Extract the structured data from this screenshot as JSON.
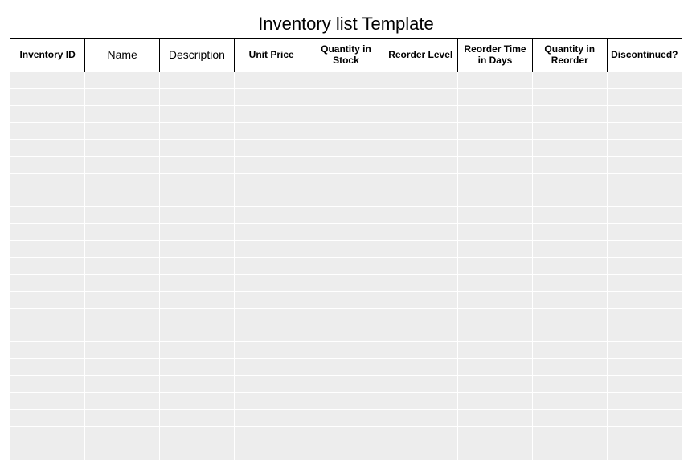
{
  "title": "Inventory list Template",
  "columns": [
    {
      "label": "Inventory ID",
      "light": false
    },
    {
      "label": "Name",
      "light": true
    },
    {
      "label": "Description",
      "light": true
    },
    {
      "label": "Unit Price",
      "light": false
    },
    {
      "label": "Quantity in Stock",
      "light": false
    },
    {
      "label": "Reorder Level",
      "light": false
    },
    {
      "label": "Reorder Time in Days",
      "light": false
    },
    {
      "label": "Quantity in Reorder",
      "light": false
    },
    {
      "label": "Discontinued?",
      "light": false
    }
  ],
  "row_count": 23
}
